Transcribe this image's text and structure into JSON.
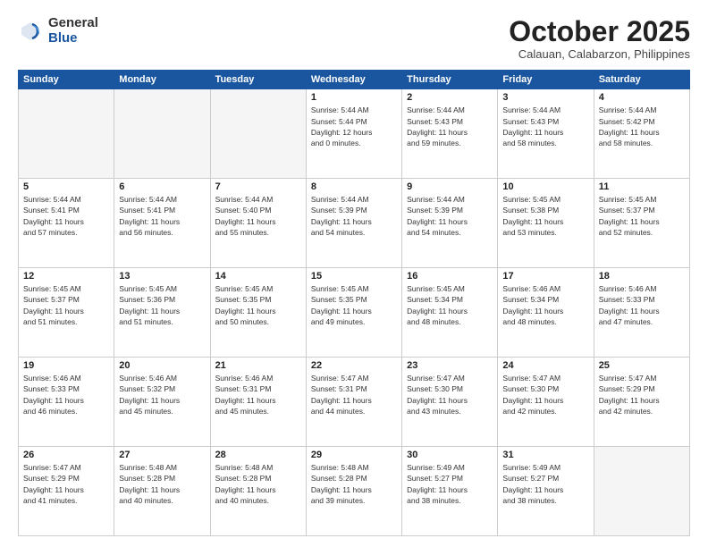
{
  "header": {
    "logo_general": "General",
    "logo_blue": "Blue",
    "month_title": "October 2025",
    "subtitle": "Calauan, Calabarzon, Philippines"
  },
  "days_of_week": [
    "Sunday",
    "Monday",
    "Tuesday",
    "Wednesday",
    "Thursday",
    "Friday",
    "Saturday"
  ],
  "weeks": [
    [
      {
        "day": "",
        "empty": true
      },
      {
        "day": "",
        "empty": true
      },
      {
        "day": "",
        "empty": true
      },
      {
        "day": "1",
        "lines": [
          "Sunrise: 5:44 AM",
          "Sunset: 5:44 PM",
          "Daylight: 12 hours",
          "and 0 minutes."
        ]
      },
      {
        "day": "2",
        "lines": [
          "Sunrise: 5:44 AM",
          "Sunset: 5:43 PM",
          "Daylight: 11 hours",
          "and 59 minutes."
        ]
      },
      {
        "day": "3",
        "lines": [
          "Sunrise: 5:44 AM",
          "Sunset: 5:43 PM",
          "Daylight: 11 hours",
          "and 58 minutes."
        ]
      },
      {
        "day": "4",
        "lines": [
          "Sunrise: 5:44 AM",
          "Sunset: 5:42 PM",
          "Daylight: 11 hours",
          "and 58 minutes."
        ]
      }
    ],
    [
      {
        "day": "5",
        "lines": [
          "Sunrise: 5:44 AM",
          "Sunset: 5:41 PM",
          "Daylight: 11 hours",
          "and 57 minutes."
        ]
      },
      {
        "day": "6",
        "lines": [
          "Sunrise: 5:44 AM",
          "Sunset: 5:41 PM",
          "Daylight: 11 hours",
          "and 56 minutes."
        ]
      },
      {
        "day": "7",
        "lines": [
          "Sunrise: 5:44 AM",
          "Sunset: 5:40 PM",
          "Daylight: 11 hours",
          "and 55 minutes."
        ]
      },
      {
        "day": "8",
        "lines": [
          "Sunrise: 5:44 AM",
          "Sunset: 5:39 PM",
          "Daylight: 11 hours",
          "and 54 minutes."
        ]
      },
      {
        "day": "9",
        "lines": [
          "Sunrise: 5:44 AM",
          "Sunset: 5:39 PM",
          "Daylight: 11 hours",
          "and 54 minutes."
        ]
      },
      {
        "day": "10",
        "lines": [
          "Sunrise: 5:45 AM",
          "Sunset: 5:38 PM",
          "Daylight: 11 hours",
          "and 53 minutes."
        ]
      },
      {
        "day": "11",
        "lines": [
          "Sunrise: 5:45 AM",
          "Sunset: 5:37 PM",
          "Daylight: 11 hours",
          "and 52 minutes."
        ]
      }
    ],
    [
      {
        "day": "12",
        "lines": [
          "Sunrise: 5:45 AM",
          "Sunset: 5:37 PM",
          "Daylight: 11 hours",
          "and 51 minutes."
        ]
      },
      {
        "day": "13",
        "lines": [
          "Sunrise: 5:45 AM",
          "Sunset: 5:36 PM",
          "Daylight: 11 hours",
          "and 51 minutes."
        ]
      },
      {
        "day": "14",
        "lines": [
          "Sunrise: 5:45 AM",
          "Sunset: 5:35 PM",
          "Daylight: 11 hours",
          "and 50 minutes."
        ]
      },
      {
        "day": "15",
        "lines": [
          "Sunrise: 5:45 AM",
          "Sunset: 5:35 PM",
          "Daylight: 11 hours",
          "and 49 minutes."
        ]
      },
      {
        "day": "16",
        "lines": [
          "Sunrise: 5:45 AM",
          "Sunset: 5:34 PM",
          "Daylight: 11 hours",
          "and 48 minutes."
        ]
      },
      {
        "day": "17",
        "lines": [
          "Sunrise: 5:46 AM",
          "Sunset: 5:34 PM",
          "Daylight: 11 hours",
          "and 48 minutes."
        ]
      },
      {
        "day": "18",
        "lines": [
          "Sunrise: 5:46 AM",
          "Sunset: 5:33 PM",
          "Daylight: 11 hours",
          "and 47 minutes."
        ]
      }
    ],
    [
      {
        "day": "19",
        "lines": [
          "Sunrise: 5:46 AM",
          "Sunset: 5:33 PM",
          "Daylight: 11 hours",
          "and 46 minutes."
        ]
      },
      {
        "day": "20",
        "lines": [
          "Sunrise: 5:46 AM",
          "Sunset: 5:32 PM",
          "Daylight: 11 hours",
          "and 45 minutes."
        ]
      },
      {
        "day": "21",
        "lines": [
          "Sunrise: 5:46 AM",
          "Sunset: 5:31 PM",
          "Daylight: 11 hours",
          "and 45 minutes."
        ]
      },
      {
        "day": "22",
        "lines": [
          "Sunrise: 5:47 AM",
          "Sunset: 5:31 PM",
          "Daylight: 11 hours",
          "and 44 minutes."
        ]
      },
      {
        "day": "23",
        "lines": [
          "Sunrise: 5:47 AM",
          "Sunset: 5:30 PM",
          "Daylight: 11 hours",
          "and 43 minutes."
        ]
      },
      {
        "day": "24",
        "lines": [
          "Sunrise: 5:47 AM",
          "Sunset: 5:30 PM",
          "Daylight: 11 hours",
          "and 42 minutes."
        ]
      },
      {
        "day": "25",
        "lines": [
          "Sunrise: 5:47 AM",
          "Sunset: 5:29 PM",
          "Daylight: 11 hours",
          "and 42 minutes."
        ]
      }
    ],
    [
      {
        "day": "26",
        "lines": [
          "Sunrise: 5:47 AM",
          "Sunset: 5:29 PM",
          "Daylight: 11 hours",
          "and 41 minutes."
        ]
      },
      {
        "day": "27",
        "lines": [
          "Sunrise: 5:48 AM",
          "Sunset: 5:28 PM",
          "Daylight: 11 hours",
          "and 40 minutes."
        ]
      },
      {
        "day": "28",
        "lines": [
          "Sunrise: 5:48 AM",
          "Sunset: 5:28 PM",
          "Daylight: 11 hours",
          "and 40 minutes."
        ]
      },
      {
        "day": "29",
        "lines": [
          "Sunrise: 5:48 AM",
          "Sunset: 5:28 PM",
          "Daylight: 11 hours",
          "and 39 minutes."
        ]
      },
      {
        "day": "30",
        "lines": [
          "Sunrise: 5:49 AM",
          "Sunset: 5:27 PM",
          "Daylight: 11 hours",
          "and 38 minutes."
        ]
      },
      {
        "day": "31",
        "lines": [
          "Sunrise: 5:49 AM",
          "Sunset: 5:27 PM",
          "Daylight: 11 hours",
          "and 38 minutes."
        ]
      },
      {
        "day": "",
        "empty": true
      }
    ]
  ]
}
